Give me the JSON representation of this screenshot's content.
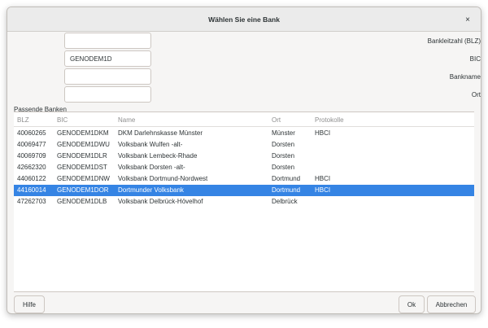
{
  "dialog": {
    "title": "Wählen Sie eine Bank",
    "close_glyph": "×"
  },
  "form": {
    "blz_label": "Bankleitzahl (BLZ)",
    "blz_value": "",
    "bic_label": "BIC",
    "bic_value": "GENODEM1D",
    "bankname_label": "Bankname",
    "bankname_value": "",
    "ort_label": "Ort",
    "ort_value": ""
  },
  "results": {
    "group_label": "Passende Banken",
    "columns": [
      "BLZ",
      "BIC",
      "Name",
      "Ort",
      "Protokolle"
    ],
    "rows": [
      {
        "blz": "40060265",
        "bic": "GENODEM1DKM",
        "name": "DKM Darlehnskasse Münster",
        "ort": "Münster",
        "protokolle": "HBCI",
        "selected": false
      },
      {
        "blz": "40069477",
        "bic": "GENODEM1DWU",
        "name": "Volksbank Wulfen -alt-",
        "ort": "Dorsten",
        "protokolle": "",
        "selected": false
      },
      {
        "blz": "40069709",
        "bic": "GENODEM1DLR",
        "name": "Volksbank Lembeck-Rhade",
        "ort": "Dorsten",
        "protokolle": "",
        "selected": false
      },
      {
        "blz": "42662320",
        "bic": "GENODEM1DST",
        "name": "Volksbank Dorsten -alt-",
        "ort": "Dorsten",
        "protokolle": "",
        "selected": false
      },
      {
        "blz": "44060122",
        "bic": "GENODEM1DNW",
        "name": "Volksbank Dortmund-Nordwest",
        "ort": "Dortmund",
        "protokolle": "HBCI",
        "selected": false
      },
      {
        "blz": "44160014",
        "bic": "GENODEM1DOR",
        "name": "Dortmunder Volksbank",
        "ort": "Dortmund",
        "protokolle": "HBCI",
        "selected": true
      },
      {
        "blz": "47262703",
        "bic": "GENODEM1DLB",
        "name": "Volksbank Delbrück-Hövelhof",
        "ort": "Delbrück",
        "protokolle": "",
        "selected": false
      }
    ]
  },
  "buttons": {
    "help_label": "Hilfe",
    "ok_label": "Ok",
    "cancel_label": "Abbrechen"
  },
  "colors": {
    "selection": "#3584e4",
    "dialog_bg": "#f6f5f4"
  }
}
